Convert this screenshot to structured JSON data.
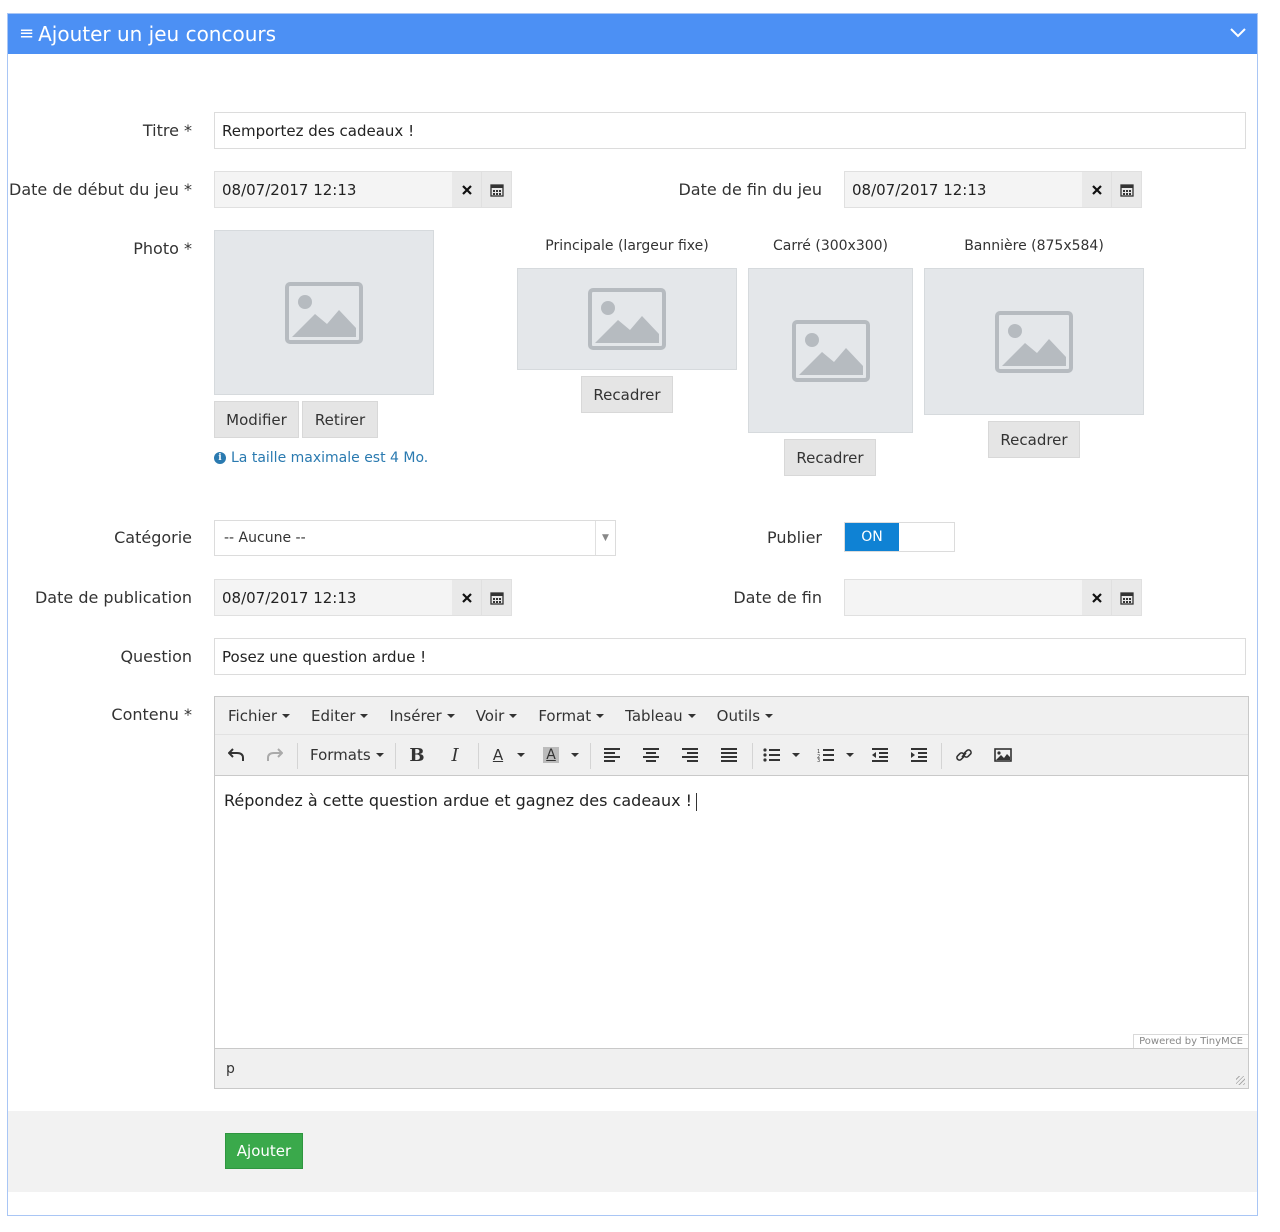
{
  "header": {
    "title": "Ajouter un jeu concours"
  },
  "form": {
    "titre": {
      "label": "Titre *",
      "value": "Remportez des cadeaux !"
    },
    "date_debut": {
      "label": "Date de début du jeu *",
      "value": "08/07/2017 12:13"
    },
    "date_fin_jeu": {
      "label": "Date de fin du jeu",
      "value": "08/07/2017 12:13"
    },
    "photo": {
      "label": "Photo *",
      "modify_label": "Modifier",
      "remove_label": "Retirer",
      "info": "La taille maximale est 4 Mo.",
      "crops": [
        {
          "label": "Principale (largeur fixe)",
          "button": "Recadrer"
        },
        {
          "label": "Carré (300x300)",
          "button": "Recadrer"
        },
        {
          "label": "Bannière (875x584)",
          "button": "Recadrer"
        }
      ]
    },
    "categorie": {
      "label": "Catégorie",
      "value": "-- Aucune --"
    },
    "publier": {
      "label": "Publier",
      "state": "ON"
    },
    "date_publication": {
      "label": "Date de publication",
      "value": "08/07/2017 12:13"
    },
    "date_fin": {
      "label": "Date de fin",
      "value": ""
    },
    "question": {
      "label": "Question",
      "value": "Posez une question ardue !"
    },
    "contenu": {
      "label": "Contenu *",
      "menu": [
        "Fichier",
        "Editer",
        "Insérer",
        "Voir",
        "Format",
        "Tableau",
        "Outils"
      ],
      "formats_label": "Formats",
      "text": "Répondez à cette question ardue et gagnez des cadeaux !",
      "powered": "Powered by TinyMCE",
      "path": "p"
    }
  },
  "actions": {
    "submit_label": "Ajouter"
  },
  "colors": {
    "header": "#4c90f4",
    "toggle_on": "#0f82d4",
    "submit": "#3aa94b",
    "info": "#2a7ab0"
  }
}
